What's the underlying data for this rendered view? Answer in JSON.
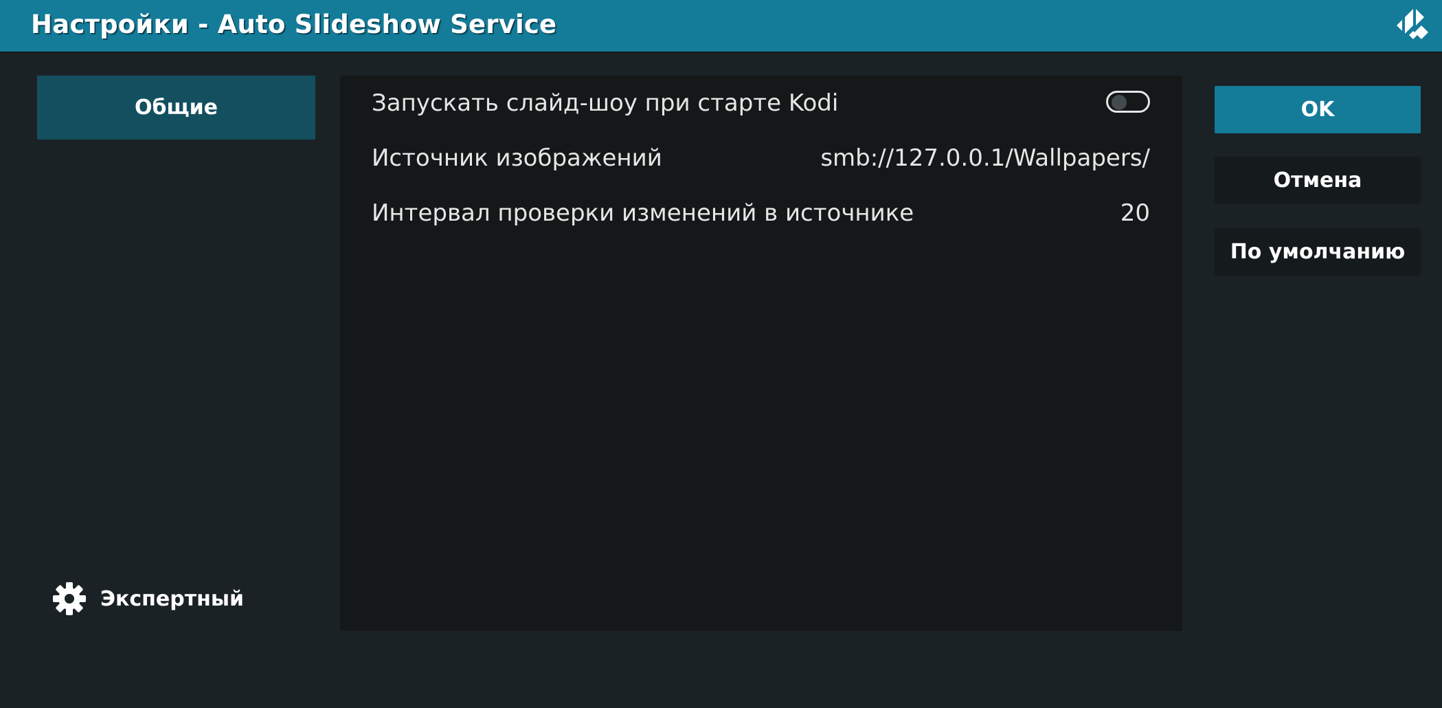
{
  "window": {
    "title": "Настройки - Auto Slideshow Service"
  },
  "sidebar": {
    "category_label": "Общие",
    "level_label": "Экспертный"
  },
  "settings": {
    "items": [
      {
        "label": "Запускать слайд-шоу при старте Kodi",
        "type": "toggle",
        "enabled": false
      },
      {
        "label": "Источник изображений",
        "type": "value",
        "value": "smb://127.0.0.1/Wallpapers/"
      },
      {
        "label": "Интервал проверки изменений в источнике",
        "type": "value",
        "value": "20"
      }
    ]
  },
  "buttons": {
    "ok": "OK",
    "cancel": "Отмена",
    "defaults": "По умолчанию"
  },
  "colors": {
    "accent": "#147b99",
    "background": "#1b2225",
    "panel": "#141819",
    "selected_category": "#134f5f"
  },
  "icons": [
    "kodi-logo-icon",
    "gear-icon"
  ]
}
